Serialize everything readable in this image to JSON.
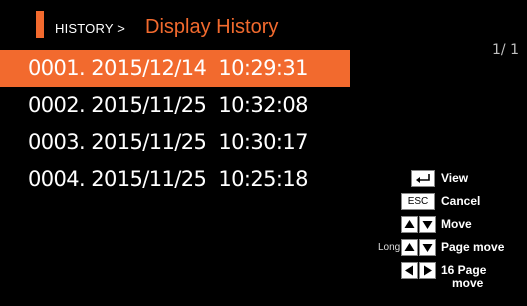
{
  "header": {
    "breadcrumb": "HISTORY >",
    "title": "Display History"
  },
  "page_indicator": "1/   1",
  "history": [
    {
      "text": "0001. 2015/12/14  10:29:31",
      "selected": true
    },
    {
      "text": "0002. 2015/11/25  10:32:08",
      "selected": false
    },
    {
      "text": "0003. 2015/11/25  10:30:17",
      "selected": false
    },
    {
      "text": "0004. 2015/11/25  10:25:18",
      "selected": false
    }
  ],
  "legend": {
    "view": {
      "label": "View",
      "icon": "enter-icon"
    },
    "cancel": {
      "label": "Cancel",
      "key": "ESC"
    },
    "move": {
      "label": "Move",
      "icons": [
        "arrow-up-icon",
        "arrow-down-icon"
      ]
    },
    "page_move": {
      "label": "Page move",
      "prefix": "Long",
      "icons": [
        "arrow-up-icon",
        "arrow-down-icon"
      ]
    },
    "page16": {
      "label_line1": "16 Page",
      "label_line2": "move",
      "icons": [
        "arrow-left-icon",
        "arrow-right-icon"
      ]
    }
  },
  "colors": {
    "accent": "#f26a2e",
    "background": "#000000"
  }
}
